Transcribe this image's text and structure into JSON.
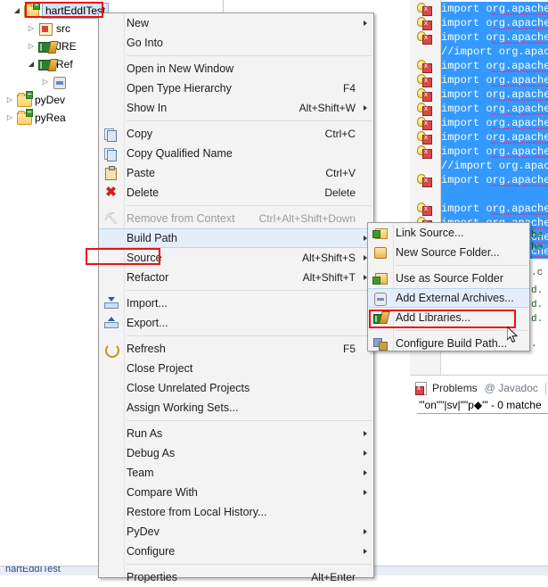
{
  "explorer": {
    "name": "package-explorer",
    "tree": [
      {
        "label": "hartEddITest",
        "icon": "java-project-icon",
        "twisty": "open",
        "indent": 12,
        "selected": true
      },
      {
        "label": "src",
        "icon": "source-folder-icon",
        "twisty": "closed",
        "indent": 28
      },
      {
        "label": "JRE",
        "icon": "library-icon",
        "twisty": "closed",
        "indent": 28
      },
      {
        "label": "Ref",
        "icon": "library-icon",
        "twisty": "open",
        "indent": 28
      },
      {
        "label": "",
        "icon": "jar-icon",
        "twisty": "closed",
        "indent": 44
      },
      {
        "label": "pyDev",
        "icon": "project-folder-icon",
        "twisty": "closed",
        "indent": 4
      },
      {
        "label": "pyRea",
        "icon": "project-folder-icon",
        "twisty": "closed",
        "indent": 4
      }
    ]
  },
  "editor": {
    "name": "java-editor",
    "lines": [
      {
        "text": "import org.apache",
        "selected": true,
        "warning": true
      },
      {
        "text": "import org.apache",
        "selected": true,
        "warning": true
      },
      {
        "text": "import org.apache",
        "selected": true,
        "warning": true
      },
      {
        "text": "//import org.apac",
        "selected": true,
        "warning": false,
        "comment": true
      },
      {
        "text": "import org.apache",
        "selected": true,
        "warning": true
      },
      {
        "text": "import org.apache",
        "selected": true,
        "warning": true
      },
      {
        "text": "import org.apache",
        "selected": true,
        "warning": true
      },
      {
        "text": "import org.apache",
        "selected": true,
        "warning": true
      },
      {
        "text": "import org.apache",
        "selected": true,
        "warning": true
      },
      {
        "text": "import org.apache",
        "selected": true,
        "warning": true
      },
      {
        "text": "import org.apache",
        "selected": true,
        "warning": true
      },
      {
        "text": "//import org.apac",
        "selected": true,
        "warning": false,
        "comment": true
      },
      {
        "text": "import org.apache",
        "selected": true,
        "warning": true
      },
      {
        "text": "",
        "selected": true,
        "warning": false
      },
      {
        "text": "import org.apache",
        "selected": true,
        "warning": true
      },
      {
        "text": "import org.apache",
        "selected": true,
        "warning": true
      },
      {
        "text": "import org.apache",
        "selected": true,
        "warning": true
      },
      {
        "text": "import org.apache",
        "selected": true,
        "warning": true
      }
    ],
    "tail_snippets": [
      "he",
      "he",
      ".c",
      "d.",
      "d.",
      "d.",
      "."
    ]
  },
  "problems": {
    "name": "problems-view",
    "tabs": [
      {
        "label": "Problems",
        "active": true,
        "icon": "problems-icon"
      },
      {
        "label": "@ Javadoc",
        "active": false,
        "icon": "javadoc-icon"
      }
    ],
    "row_text": "'\"on\"\"|sv|\"\"p◆\"' - 0 matche"
  },
  "statusbar": {
    "text": "hartEddITest"
  },
  "context_menu": {
    "name": "project-context-menu",
    "items": [
      {
        "type": "item",
        "label": "New",
        "accel": "",
        "arrow": true,
        "icon": "",
        "enabled": true
      },
      {
        "type": "item",
        "label": "Go Into",
        "accel": "",
        "arrow": false,
        "icon": "",
        "enabled": true
      },
      {
        "type": "sep"
      },
      {
        "type": "item",
        "label": "Open in New Window",
        "accel": "",
        "arrow": false,
        "icon": "",
        "enabled": true
      },
      {
        "type": "item",
        "label": "Open Type Hierarchy",
        "accel": "F4",
        "arrow": false,
        "icon": "",
        "enabled": true
      },
      {
        "type": "item",
        "label": "Show In",
        "accel": "Alt+Shift+W",
        "arrow": true,
        "icon": "",
        "enabled": true
      },
      {
        "type": "sep"
      },
      {
        "type": "item",
        "label": "Copy",
        "accel": "Ctrl+C",
        "arrow": false,
        "icon": "copy-icon",
        "enabled": true
      },
      {
        "type": "item",
        "label": "Copy Qualified Name",
        "accel": "",
        "arrow": false,
        "icon": "copy-qualified-icon",
        "enabled": true
      },
      {
        "type": "item",
        "label": "Paste",
        "accel": "Ctrl+V",
        "arrow": false,
        "icon": "paste-icon",
        "enabled": true
      },
      {
        "type": "item",
        "label": "Delete",
        "accel": "Delete",
        "arrow": false,
        "icon": "delete-icon",
        "enabled": true
      },
      {
        "type": "sep"
      },
      {
        "type": "item",
        "label": "Remove from Context",
        "accel": "Ctrl+Alt+Shift+Down",
        "arrow": false,
        "icon": "remove-context-icon",
        "enabled": false
      },
      {
        "type": "item",
        "label": "Build Path",
        "accel": "",
        "arrow": true,
        "icon": "",
        "enabled": true,
        "highlighted": true
      },
      {
        "type": "item",
        "label": "Source",
        "accel": "Alt+Shift+S",
        "arrow": true,
        "icon": "",
        "enabled": true
      },
      {
        "type": "item",
        "label": "Refactor",
        "accel": "Alt+Shift+T",
        "arrow": true,
        "icon": "",
        "enabled": true
      },
      {
        "type": "sep"
      },
      {
        "type": "item",
        "label": "Import...",
        "accel": "",
        "arrow": false,
        "icon": "import-icon",
        "enabled": true
      },
      {
        "type": "item",
        "label": "Export...",
        "accel": "",
        "arrow": false,
        "icon": "export-icon",
        "enabled": true
      },
      {
        "type": "sep"
      },
      {
        "type": "item",
        "label": "Refresh",
        "accel": "F5",
        "arrow": false,
        "icon": "refresh-icon",
        "enabled": true
      },
      {
        "type": "item",
        "label": "Close Project",
        "accel": "",
        "arrow": false,
        "icon": "",
        "enabled": true
      },
      {
        "type": "item",
        "label": "Close Unrelated Projects",
        "accel": "",
        "arrow": false,
        "icon": "",
        "enabled": true
      },
      {
        "type": "item",
        "label": "Assign Working Sets...",
        "accel": "",
        "arrow": false,
        "icon": "",
        "enabled": true
      },
      {
        "type": "sep"
      },
      {
        "type": "item",
        "label": "Run As",
        "accel": "",
        "arrow": true,
        "icon": "",
        "enabled": true
      },
      {
        "type": "item",
        "label": "Debug As",
        "accel": "",
        "arrow": true,
        "icon": "",
        "enabled": true
      },
      {
        "type": "item",
        "label": "Team",
        "accel": "",
        "arrow": true,
        "icon": "",
        "enabled": true
      },
      {
        "type": "item",
        "label": "Compare With",
        "accel": "",
        "arrow": true,
        "icon": "",
        "enabled": true
      },
      {
        "type": "item",
        "label": "Restore from Local History...",
        "accel": "",
        "arrow": false,
        "icon": "",
        "enabled": true
      },
      {
        "type": "item",
        "label": "PyDev",
        "accel": "",
        "arrow": true,
        "icon": "",
        "enabled": true
      },
      {
        "type": "item",
        "label": "Configure",
        "accel": "",
        "arrow": true,
        "icon": "",
        "enabled": true
      },
      {
        "type": "sep"
      },
      {
        "type": "item",
        "label": "Properties",
        "accel": "Alt+Enter",
        "arrow": false,
        "icon": "",
        "enabled": true
      }
    ]
  },
  "build_path_submenu": {
    "name": "build-path-submenu",
    "items": [
      {
        "type": "item",
        "label": "Link Source...",
        "icon": "link-source-icon"
      },
      {
        "type": "item",
        "label": "New Source Folder...",
        "icon": "new-source-folder-icon"
      },
      {
        "type": "sep"
      },
      {
        "type": "item",
        "label": "Use as Source Folder",
        "icon": "use-as-source-folder-icon"
      },
      {
        "type": "item",
        "label": "Add External Archives...",
        "icon": "add-external-archives-icon",
        "highlighted": true
      },
      {
        "type": "item",
        "label": "Add Libraries...",
        "icon": "add-libraries-icon"
      },
      {
        "type": "sep"
      },
      {
        "type": "item",
        "label": "Configure Build Path...",
        "icon": "configure-build-path-icon"
      }
    ]
  },
  "annotations": {
    "highlight_color": "#ee1111",
    "selection_color": "#3399ff",
    "menu_hover_color": "#e4eefb"
  }
}
